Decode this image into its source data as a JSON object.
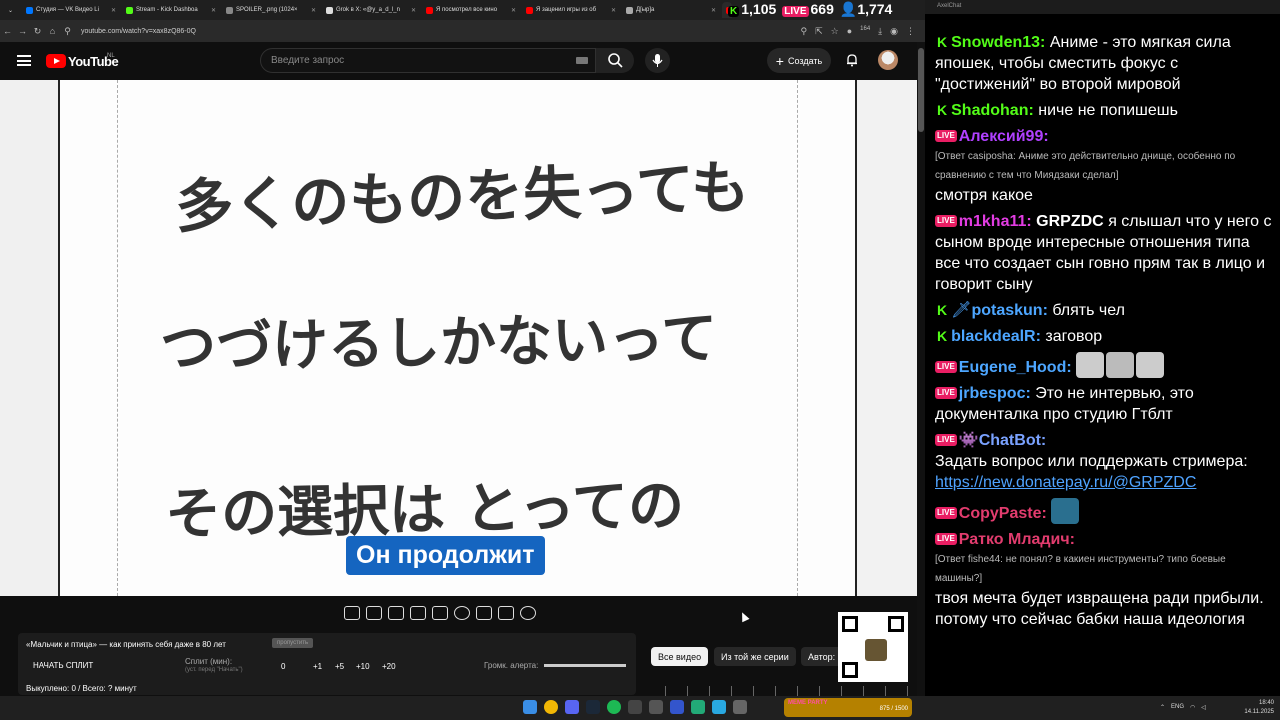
{
  "browser": {
    "tabs": [
      {
        "label": "Студия — VK Видео Li",
        "color": "#0077ff"
      },
      {
        "label": "Stream - Kick Dashboa",
        "color": "#53fc18"
      },
      {
        "label": "SPOILER_.png (1024×",
        "color": "#888888"
      },
      {
        "label": "Grok в X: «@y_a_d_l_n",
        "color": "#dddddd"
      },
      {
        "label": "Я посмотрел все кино",
        "color": "#ff0000"
      },
      {
        "label": "Я заценил игры из об",
        "color": "#ff0000"
      },
      {
        "label": "Д[ыр]а",
        "color": "#aaaaaa"
      }
    ],
    "url": "youtube.com/watch?v=xax8zQ86-0Q",
    "extension_badge": "164"
  },
  "stream_stats": {
    "kick_viewers": "1,105",
    "vk_viewers": "669",
    "total_viewers": "1,774"
  },
  "youtube": {
    "logo_text": "YouTube",
    "region": "NL",
    "search_placeholder": "Введите запрос",
    "create_label": "Создать"
  },
  "video": {
    "handwriting": [
      "多くのものを失っても",
      "つづけるしかないって",
      "その選択は とっての"
    ],
    "subtitle": "Он продолжит"
  },
  "widget": {
    "title": "«Мальчик и птица» — как принять себя даже в 80 лет",
    "title_button": "пропустить",
    "start_label": "НАЧАТЬ СПЛИТ",
    "split_label": "Сплит (мин):",
    "split_hint": "(уст. перед \"Начать\")",
    "split_value": "0",
    "increments": [
      "+1",
      "+5",
      "+10",
      "+20"
    ],
    "alert_label": "Громк. алерта:",
    "status": "Выкуплено: 0 / Всего: ? минут"
  },
  "chips": [
    "Все видео",
    "Из той же серии",
    "Автор:"
  ],
  "chat": {
    "window_title": "AxelChat",
    "messages": [
      {
        "platform": "kick",
        "user": "Snowden13",
        "color": "#53fc18",
        "text": "Аниме - это мягкая сила япошек, чтобы сместить фокус с \"достижений\" во второй мировой"
      },
      {
        "platform": "kick",
        "user": "Shadohan",
        "color": "#53fc18",
        "text": "ниче не попишешь"
      },
      {
        "platform": "live",
        "user": "Алексий99",
        "color": "#b040ff",
        "reply": "[Ответ casiposha: Аниме это действительно днище, особенно по сравнению с тем что Миядзаки сделал]",
        "text": "смотря какое"
      },
      {
        "platform": "live",
        "user": "m1kha11",
        "color": "#e23ce2",
        "mention": "GRPZDC",
        "text": "я слышал что у него с сыном вроде интересные отношения типа все что создает сын говно прям так в лицо и говорит сыну"
      },
      {
        "platform": "kick",
        "user": "potaskun",
        "color": "#4da6ff",
        "text": "блять чел"
      },
      {
        "platform": "kick",
        "user": "blackdealR",
        "color": "#4da6ff",
        "text": "заговор"
      },
      {
        "platform": "live",
        "user": "Eugene_Hood",
        "color": "#4da6ff",
        "text": ""
      },
      {
        "platform": "live",
        "user": "jrbespoc",
        "color": "#4da6ff",
        "text": "Это не интервью, это документалка про студию Гтблт"
      },
      {
        "platform": "live",
        "user": "ChatBot",
        "color": "#7aa2ff",
        "text": "Задать вопрос или поддержать стримера:",
        "link": "https://new.donatepay.ru/@GRPZDC"
      },
      {
        "platform": "live",
        "user": "CopyPaste",
        "color": "#e23c6e",
        "text": ""
      },
      {
        "platform": "live",
        "user": "Ратко Младич",
        "color": "#e23c6e",
        "reply": "[Ответ fishe44: не понял? в какиен инструменты? типо боевые машины?]",
        "text": "твоя мечта будет извращена ради прибыли. потому что сейчас бабки наша идеология"
      }
    ]
  },
  "taskbar": {
    "music_label": "MEME PARTY",
    "music_progress": "875 / 1500",
    "lang": "ENG",
    "time": "18:40",
    "date": "14.11.2025"
  }
}
